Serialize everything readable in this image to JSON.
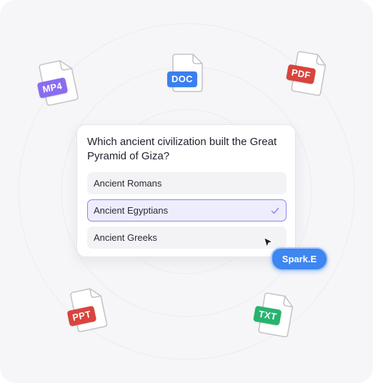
{
  "quiz": {
    "question": "Which ancient civilization built the Great Pyramid of Giza?",
    "options": [
      {
        "label": "Ancient Romans",
        "selected": false
      },
      {
        "label": "Ancient Egyptians",
        "selected": true
      },
      {
        "label": "Ancient Greeks",
        "selected": false
      }
    ]
  },
  "cursor": {
    "label": "Spark.E"
  },
  "files": [
    {
      "type": "MP4",
      "color": "#8b6cf0"
    },
    {
      "type": "DOC",
      "color": "#3b7ff0"
    },
    {
      "type": "PDF",
      "color": "#d8443e"
    },
    {
      "type": "PPT",
      "color": "#d8443e"
    },
    {
      "type": "TXT",
      "color": "#27b36e"
    }
  ],
  "icons": {
    "check": "check-icon",
    "cursor": "mouse-pointer-icon",
    "file": "document-icon"
  },
  "colors": {
    "selected_border": "#8b87e6",
    "selected_bg": "#eeedfe",
    "pill_bg": "#3e86f0"
  }
}
